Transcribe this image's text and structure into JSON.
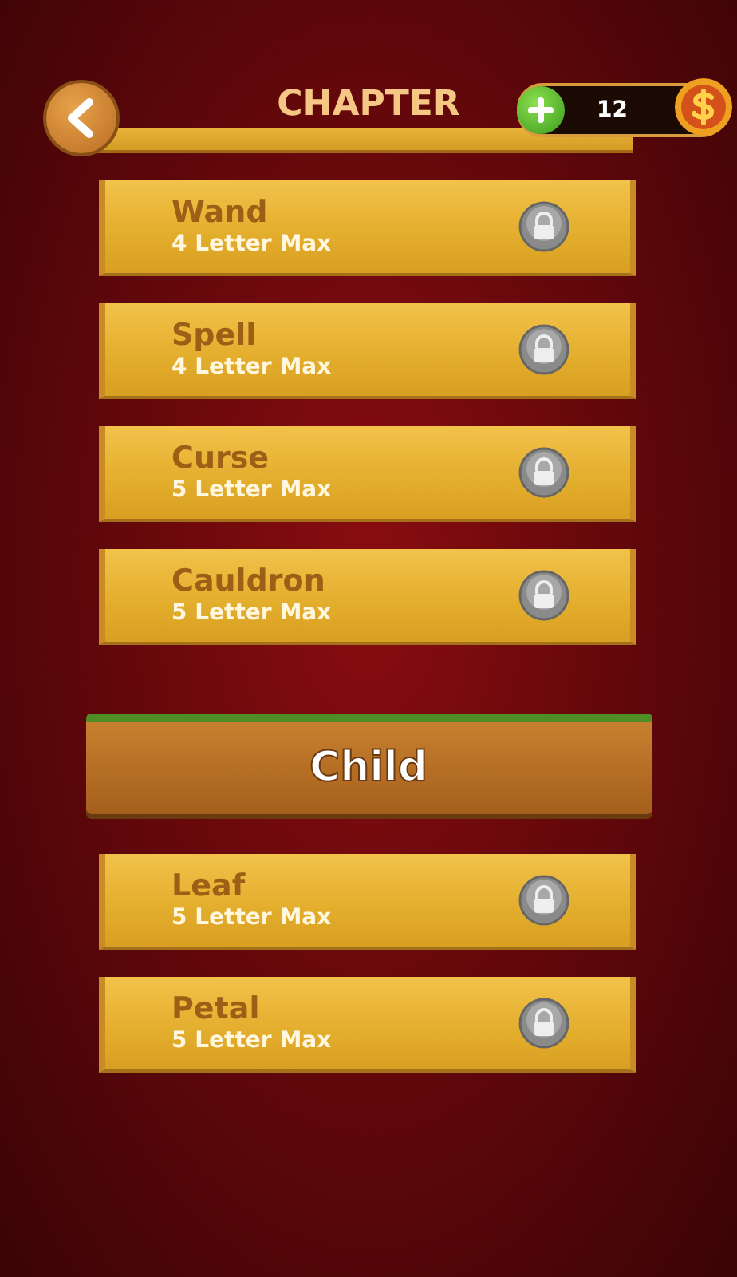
{
  "header": {
    "title": "CHAPTER",
    "coins": "12"
  },
  "items": [
    {
      "kind": "level",
      "name": "Wand",
      "max": "4 Letter Max",
      "locked": true
    },
    {
      "kind": "level",
      "name": "Spell",
      "max": "4 Letter Max",
      "locked": true
    },
    {
      "kind": "level",
      "name": "Curse",
      "max": "5 Letter Max",
      "locked": true
    },
    {
      "kind": "level",
      "name": "Cauldron",
      "max": "5 Letter Max",
      "locked": true
    },
    {
      "kind": "category",
      "name": "Child"
    },
    {
      "kind": "level",
      "name": "Leaf",
      "max": "5 Letter Max",
      "locked": true
    },
    {
      "kind": "level",
      "name": "Petal",
      "max": "5 Letter Max",
      "locked": true
    }
  ]
}
